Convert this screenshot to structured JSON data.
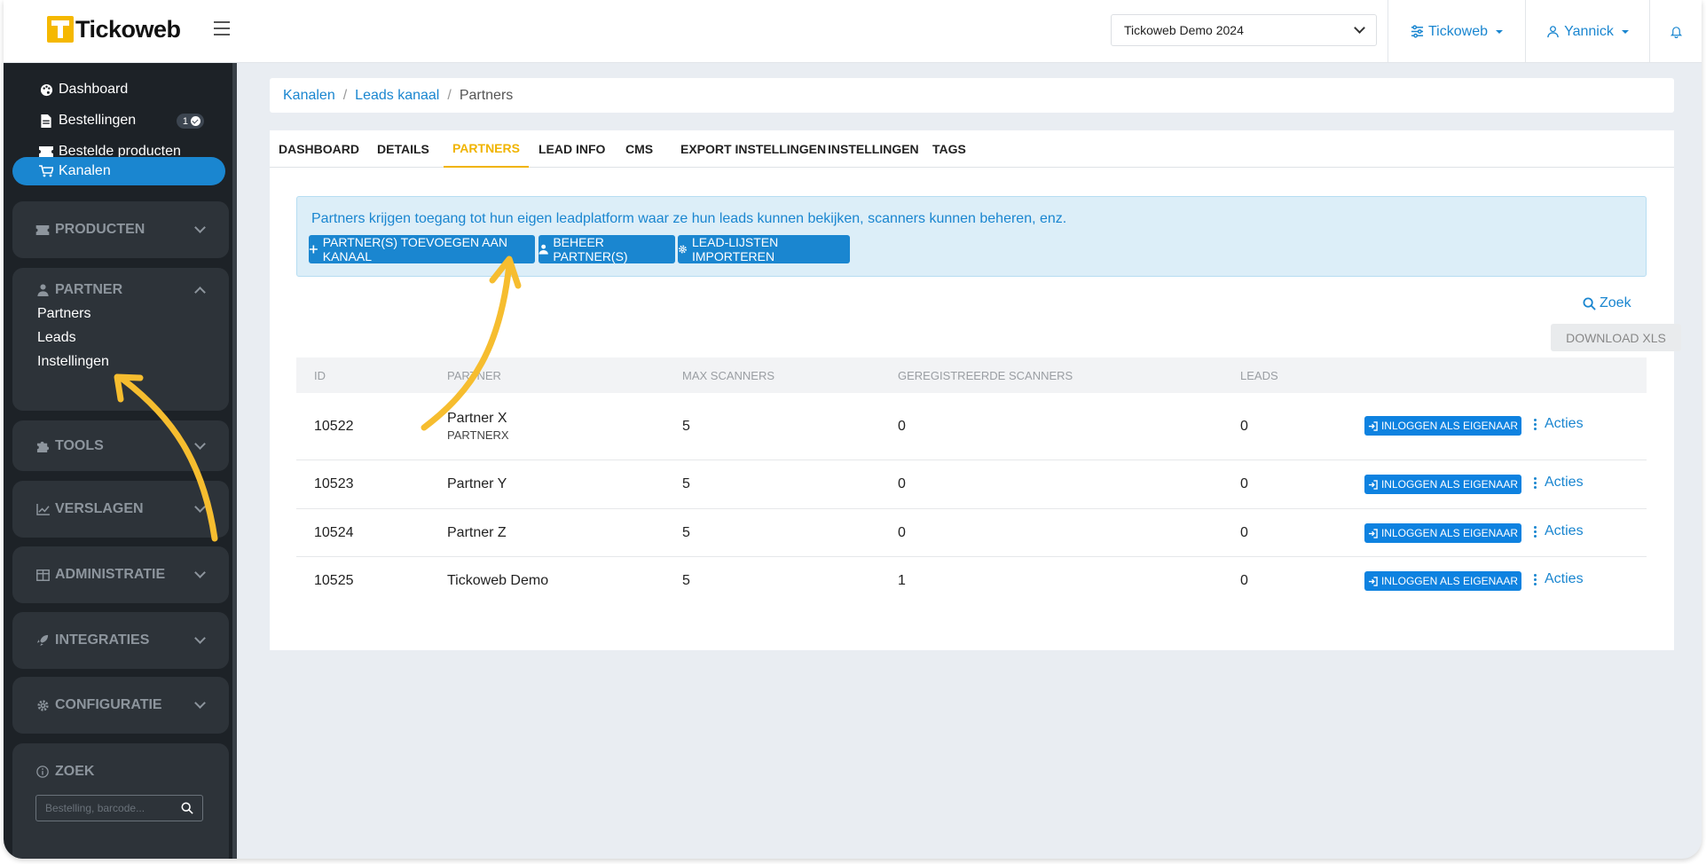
{
  "app": {
    "logo_text": "Tickoweb"
  },
  "topbar": {
    "event_select": "Tickoweb Demo 2024",
    "org_menu": "Tickoweb",
    "user_menu": "Yannick"
  },
  "sidebar": {
    "links": [
      {
        "label": "Dashboard",
        "icon": "palette-icon"
      },
      {
        "label": "Bestellingen",
        "icon": "file-icon",
        "badge": "1"
      },
      {
        "label": "Bestelde producten",
        "icon": "ticket-icon"
      },
      {
        "label": "Kanalen",
        "icon": "cart-icon",
        "active": true
      }
    ],
    "groups": {
      "producten": "PRODUCTEN",
      "partner": "PARTNER",
      "tools": "TOOLS",
      "verslagen": "VERSLAGEN",
      "administratie": "ADMINISTRATIE",
      "integraties": "INTEGRATIES",
      "configuratie": "CONFIGURATIE",
      "zoek": "ZOEK"
    },
    "partner_items": [
      "Partners",
      "Leads",
      "Instellingen"
    ],
    "search_placeholder": "Bestelling, barcode..."
  },
  "breadcrumb": {
    "items": [
      "Kanalen",
      "Leads kanaal"
    ],
    "current": "Partners"
  },
  "tabs": [
    "DASHBOARD",
    "DETAILS",
    "PARTNERS",
    "LEAD INFO",
    "CMS",
    "EXPORT INSTELLINGEN",
    "INSTELLINGEN",
    "TAGS"
  ],
  "active_tab": "PARTNERS",
  "alert": {
    "text": "Partners krijgen toegang tot hun eigen leadplatform waar ze hun leads kunnen bekijken, scanners kunnen beheren, enz.",
    "buttons": [
      "PARTNER(S) TOEVOEGEN AAN KANAAL",
      "BEHEER PARTNER(S)",
      "LEAD-LIJSTEN IMPORTEREN"
    ]
  },
  "toolbar": {
    "search": "Zoek",
    "download": "DOWNLOAD XLS"
  },
  "table": {
    "headers": [
      "ID",
      "PARTNER",
      "MAX SCANNERS",
      "GEREGISTREERDE SCANNERS",
      "LEADS"
    ],
    "login_label": "INLOGGEN ALS EIGENAAR",
    "actions_label": "Acties",
    "rows": [
      {
        "id": "10522",
        "partner": "Partner X",
        "code": "PARTNERX",
        "max": "5",
        "registered": "0",
        "leads": "0"
      },
      {
        "id": "10523",
        "partner": "Partner Y",
        "code": "",
        "max": "5",
        "registered": "0",
        "leads": "0"
      },
      {
        "id": "10524",
        "partner": "Partner Z",
        "code": "",
        "max": "5",
        "registered": "0",
        "leads": "0"
      },
      {
        "id": "10525",
        "partner": "Tickoweb Demo",
        "code": "",
        "max": "5",
        "registered": "1",
        "leads": "0"
      }
    ]
  },
  "colors": {
    "accent": "#1a86d0",
    "active_tab": "#f0b400",
    "sidebar": "#1d2227",
    "annotation_arrow": "#f6bd2f"
  }
}
